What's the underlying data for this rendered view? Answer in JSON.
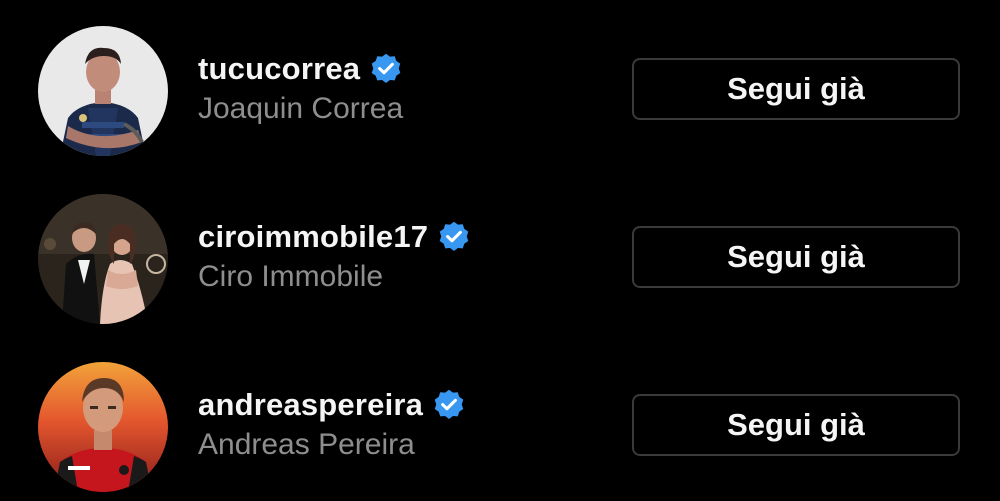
{
  "colors": {
    "background": "#000000",
    "username": "#f5f5f5",
    "fullname": "#8e8e8e",
    "verified_badge": "#3897f0",
    "button_border": "#3a3a3a"
  },
  "following_list": [
    {
      "username": "tucucorrea",
      "full_name": "Joaquin Correa",
      "verified": true,
      "button_label": "Segui già",
      "avatar_icon": "profile-photo"
    },
    {
      "username": "ciroimmobile17",
      "full_name": "Ciro Immobile",
      "verified": true,
      "button_label": "Segui già",
      "avatar_icon": "profile-photo"
    },
    {
      "username": "andreaspereira",
      "full_name": "Andreas Pereira",
      "verified": true,
      "button_label": "Segui già",
      "avatar_icon": "profile-photo"
    }
  ]
}
